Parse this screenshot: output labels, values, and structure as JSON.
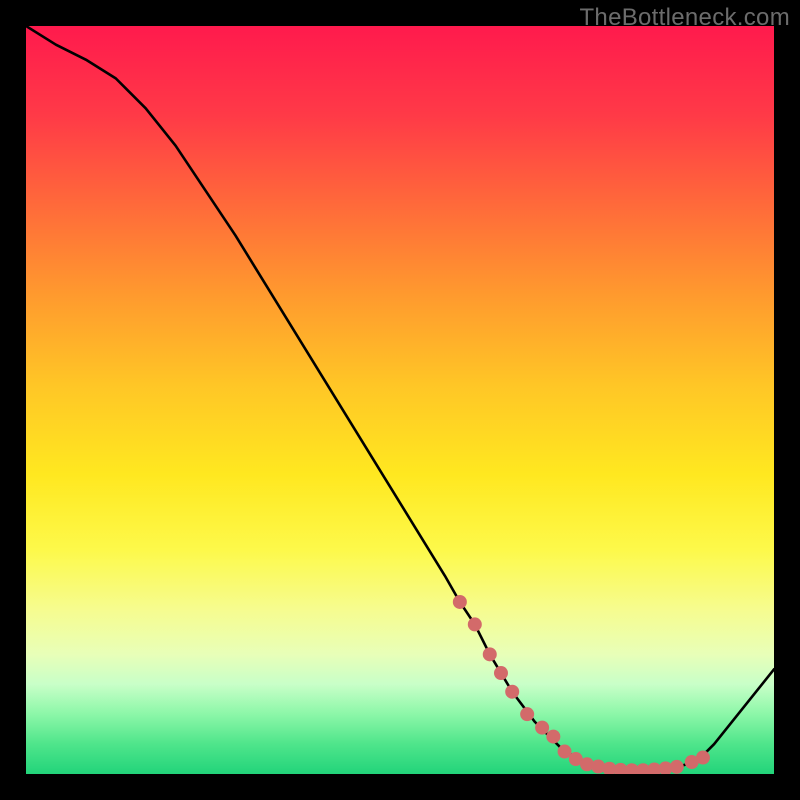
{
  "watermark": "TheBottleneck.com",
  "chart_data": {
    "type": "line",
    "title": "",
    "xlabel": "",
    "ylabel": "",
    "xlim": [
      0,
      100
    ],
    "ylim": [
      0,
      100
    ],
    "grid": false,
    "series": [
      {
        "name": "curve",
        "color": "#000000",
        "x": [
          0,
          4,
          8,
          12,
          16,
          20,
          24,
          28,
          32,
          36,
          40,
          44,
          48,
          52,
          56,
          58,
          60,
          62,
          65,
          68,
          72,
          76,
          80,
          83,
          86,
          88,
          90,
          92,
          96,
          100
        ],
        "values": [
          100,
          97.5,
          95.5,
          93,
          89,
          84,
          78,
          72,
          65.5,
          59,
          52.5,
          46,
          39.5,
          33,
          26.5,
          23,
          20,
          16,
          11,
          7,
          3,
          1,
          0.5,
          0.5,
          0.8,
          1.2,
          2,
          4,
          9,
          14
        ]
      }
    ],
    "markers": {
      "name": "dots",
      "color": "#d36a6a",
      "radius": 7,
      "x": [
        58,
        60,
        62,
        63.5,
        65,
        67,
        69,
        70.5,
        72,
        73.5,
        75,
        76.5,
        78,
        79.5,
        81,
        82.5,
        84,
        85.5,
        87,
        89,
        90.5
      ],
      "values": [
        23,
        20,
        16,
        13.5,
        11,
        8,
        6.2,
        5,
        3,
        2,
        1.3,
        1,
        0.7,
        0.55,
        0.5,
        0.5,
        0.6,
        0.75,
        0.95,
        1.6,
        2.2
      ]
    }
  }
}
